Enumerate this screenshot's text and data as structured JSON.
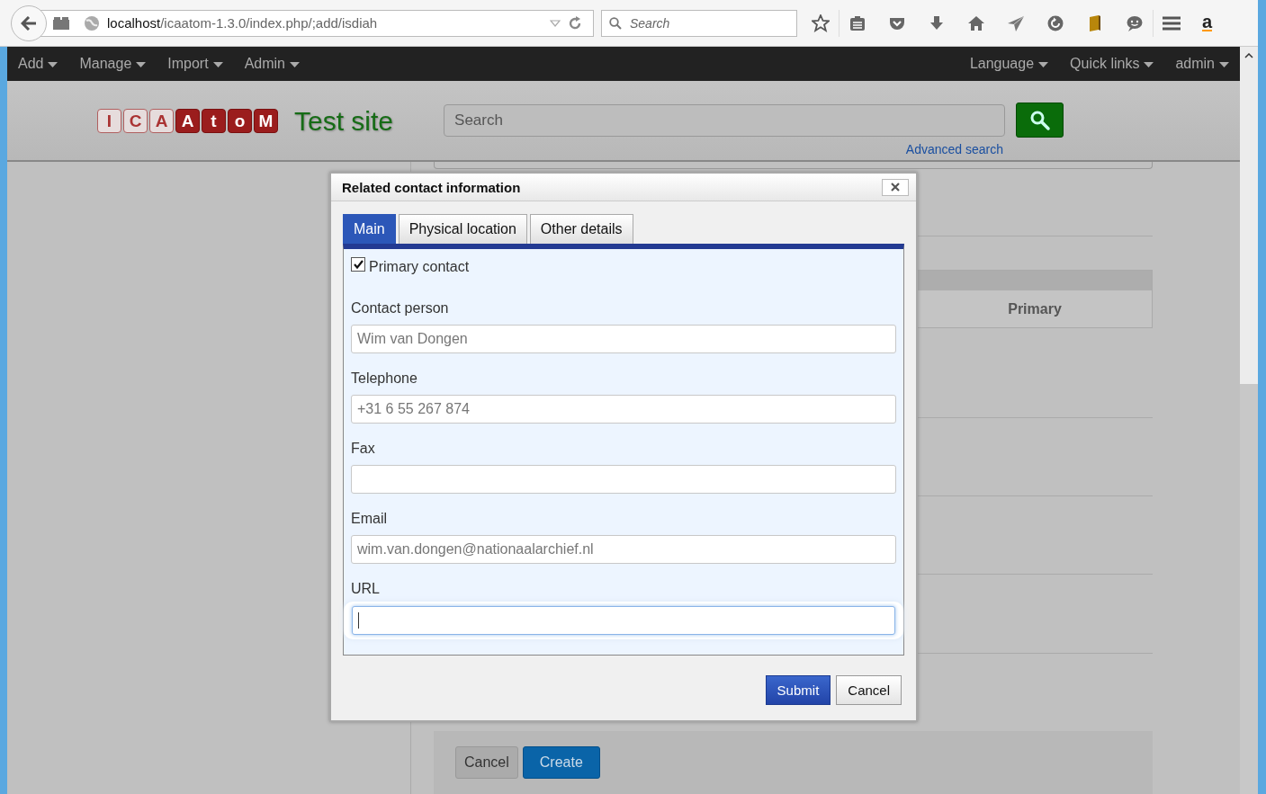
{
  "browser": {
    "address": {
      "host": "localhost",
      "path": "/icaatom-1.3.0/index.php/;add/isdiah"
    },
    "search": {
      "placeholder": "Search"
    },
    "extension_label": "a"
  },
  "nav": {
    "left": [
      "Add",
      "Manage",
      "Import",
      "Admin"
    ],
    "right": [
      "Language",
      "Quick links",
      "admin"
    ]
  },
  "header": {
    "logo_letters": [
      {
        "letter": "I",
        "filled": false
      },
      {
        "letter": "C",
        "filled": false
      },
      {
        "letter": "A",
        "filled": false
      },
      {
        "letter": "A",
        "filled": true
      },
      {
        "letter": "t",
        "filled": true
      },
      {
        "letter": "o",
        "filled": true
      },
      {
        "letter": "M",
        "filled": true
      }
    ],
    "site_title": "Test site",
    "search": {
      "placeholder": "Search"
    },
    "advanced_search": "Advanced search"
  },
  "page": {
    "table_header": "Primary",
    "buttons": [
      {
        "label": "Cancel",
        "kind": "secondary"
      },
      {
        "label": "Create",
        "kind": "primary"
      }
    ]
  },
  "dialog": {
    "title": "Related contact information",
    "tabs": [
      {
        "label": "Main",
        "selected": true
      },
      {
        "label": "Physical location",
        "selected": false
      },
      {
        "label": "Other details",
        "selected": false
      }
    ],
    "primary_contact": {
      "label": "Primary contact",
      "checked": true
    },
    "fields": [
      {
        "label": "Contact person",
        "value": "Wim van Dongen",
        "focused": false
      },
      {
        "label": "Telephone",
        "value": "+31 6 55 267 874",
        "focused": false
      },
      {
        "label": "Fax",
        "focused": false
      },
      {
        "label": "Email",
        "value": "wim.van.dongen@nationaalarchief.nl",
        "focused": false
      },
      {
        "label": "URL",
        "focused": true
      }
    ],
    "buttons": [
      {
        "label": "Submit",
        "kind": "primary"
      },
      {
        "label": "Cancel",
        "kind": "secondary"
      }
    ]
  }
}
